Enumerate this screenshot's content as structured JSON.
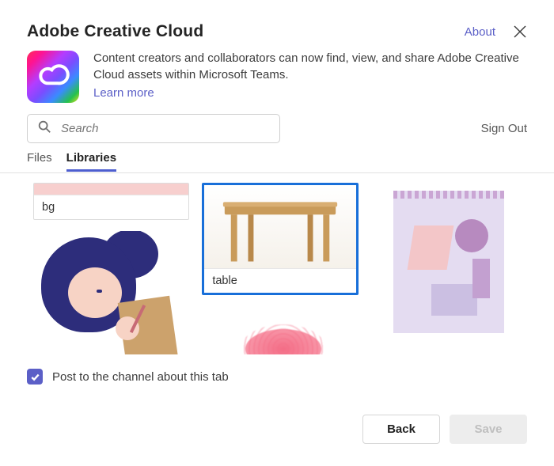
{
  "header": {
    "title": "Adobe Creative Cloud",
    "about": "About"
  },
  "intro": {
    "text": "Content creators and collaborators can now find, view, and share Adobe Creative Cloud assets within Microsoft Teams.",
    "learn_more": "Learn more"
  },
  "search": {
    "placeholder": "Search"
  },
  "signout": "Sign Out",
  "tabs": {
    "files": "Files",
    "libraries": "Libraries",
    "active": "libraries"
  },
  "tiles": {
    "bg": "bg",
    "table": "table"
  },
  "post": {
    "label": "Post to the channel about this tab",
    "checked": true
  },
  "buttons": {
    "back": "Back",
    "save": "Save"
  }
}
